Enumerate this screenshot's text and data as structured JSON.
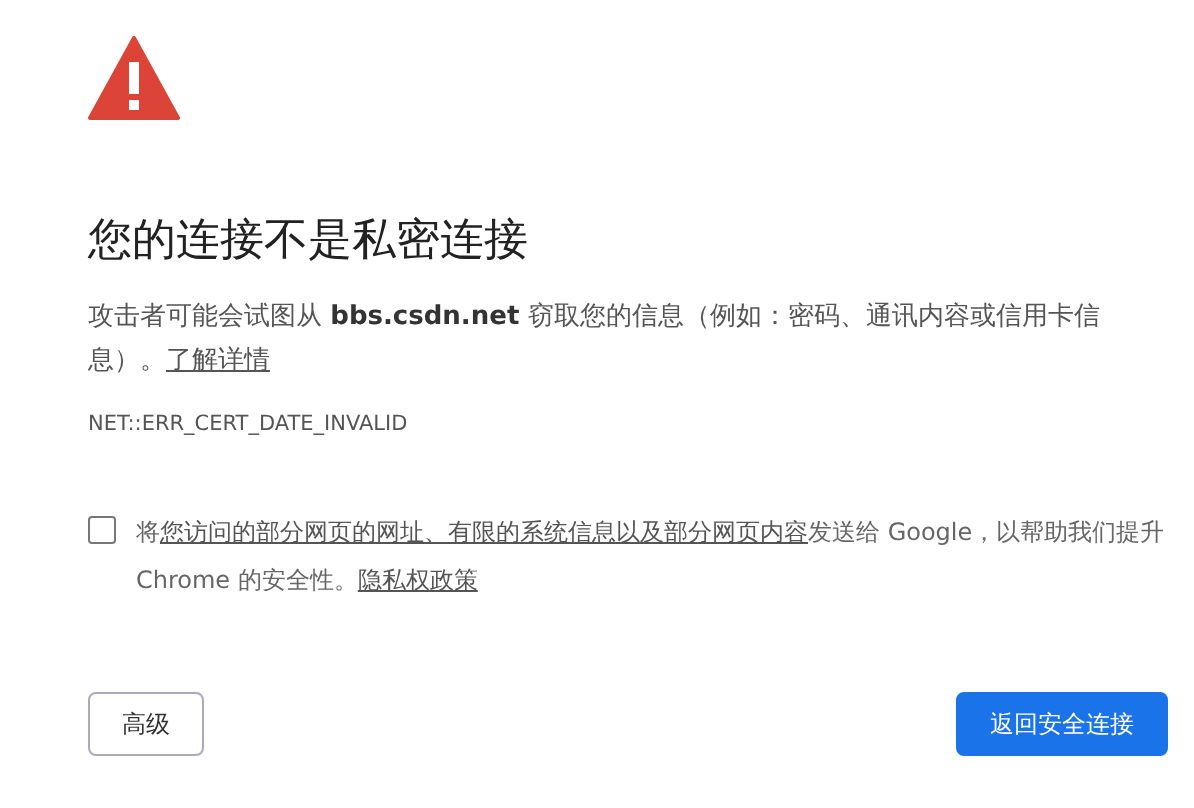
{
  "heading": "您的连接不是私密连接",
  "description": {
    "text": "攻击者可能会试图从 **bbs.csdn.net** 窃取您的信息（例如：密码、通讯内容或信用卡信息）。",
    "link": "了解详情"
  },
  "error_code": "NET::ERR_CERT_DATE_INVALID",
  "report_option": {
    "checked": false,
    "before": "将",
    "link": "您访问的部分网页的网址、有限的系统信息以及部分网页内容",
    "after": "发送给 Google，以帮助我们提升 Chrome 的安全性。",
    "policy_link": "隐私权政策"
  },
  "buttons": [
    {
      "label": "高级",
      "kind": "secondary"
    },
    {
      "label": "返回安全连接",
      "kind": "primary"
    }
  ]
}
